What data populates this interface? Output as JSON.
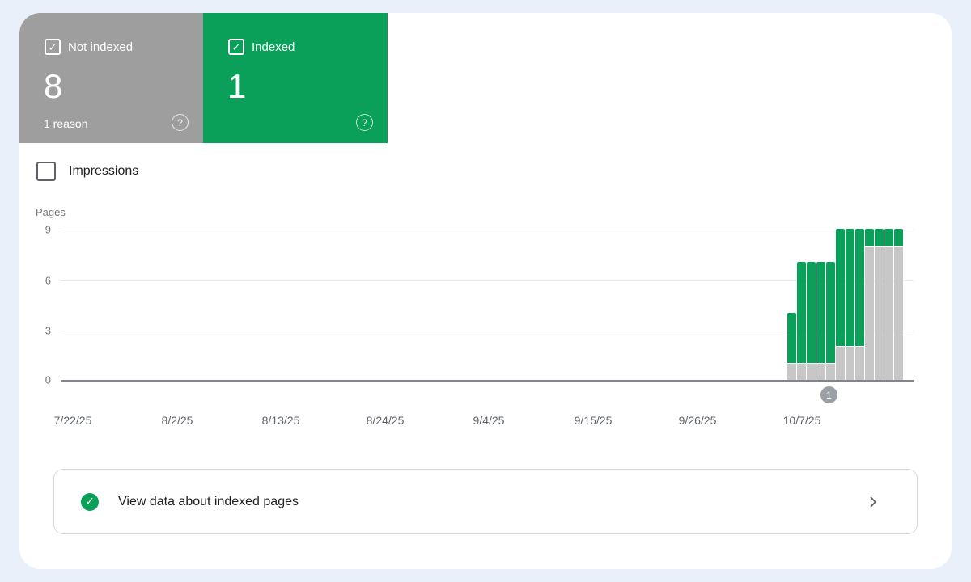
{
  "colors": {
    "green": "#0AA05A",
    "card_gray": "#9E9E9E",
    "bar_gray": "#C7C7C7",
    "grid": "#E8EAED",
    "axis": "#80868B",
    "text_muted": "#5F6368",
    "text_dark": "#202124",
    "border": "#DADCE0",
    "marker_gray": "#9AA0A6",
    "page_bg": "#E9F0FA"
  },
  "cards": {
    "not_indexed": {
      "label": "Not indexed",
      "value": "8",
      "sub_label": "1 reason",
      "check_icon": "✓",
      "help_icon": "?"
    },
    "indexed": {
      "label": "Indexed",
      "value": "1",
      "check_icon": "✓",
      "help_icon": "?"
    }
  },
  "filters": {
    "impressions": {
      "label": "Impressions",
      "checked": false
    }
  },
  "chart_data": {
    "type": "bar",
    "stacked": true,
    "title": "",
    "ylabel": "Pages",
    "ylim": [
      0,
      9
    ],
    "yticks": [
      "9",
      "6",
      "3",
      "0"
    ],
    "x_tick_labels": [
      "7/22/25",
      "8/2/25",
      "8/13/25",
      "8/24/25",
      "9/4/25",
      "9/15/25",
      "9/26/25",
      "10/7/25"
    ],
    "grid": "horizontal",
    "legend_position": "top-cards",
    "series": [
      {
        "name": "Not indexed",
        "color": "#C7C7C7",
        "values": [
          1,
          1,
          1,
          1,
          1,
          2,
          2,
          2,
          8,
          8,
          8,
          8
        ]
      },
      {
        "name": "Indexed",
        "color": "#0AA05A",
        "values": [
          3,
          6,
          6,
          6,
          6,
          7,
          7,
          7,
          1,
          1,
          1,
          1
        ]
      }
    ],
    "annotation_marker": {
      "label": "1"
    }
  },
  "banner": {
    "text": "View data about indexed pages",
    "check_icon": "✓"
  }
}
